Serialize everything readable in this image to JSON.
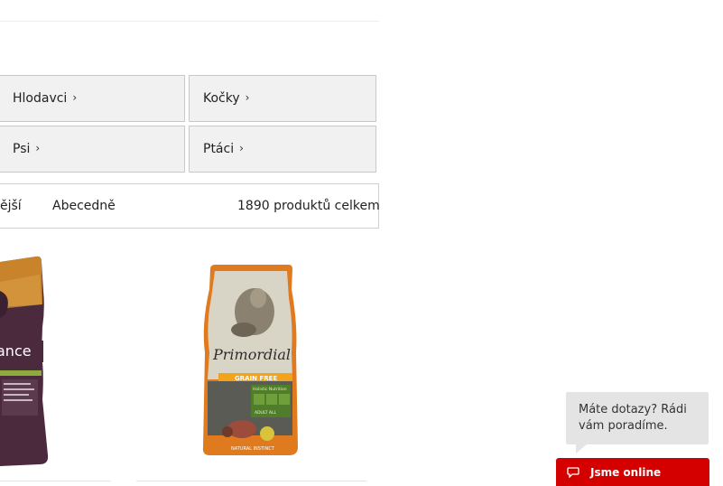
{
  "categories": [
    {
      "label": "Hlodavci",
      "chevron": "›"
    },
    {
      "label": "Kočky",
      "chevron": "›"
    },
    {
      "label": "Psi",
      "chevron": "›"
    },
    {
      "label": "Ptáci",
      "chevron": "›"
    }
  ],
  "sort": {
    "option_partial": "ější",
    "option_alpha": "Abecedně",
    "total": "1890 produktů celkem"
  },
  "products": [
    {
      "brand_text": "ance"
    },
    {
      "brand_text": "Primordial",
      "badge": "GRAIN FREE",
      "sub": "Holistic Nutrition",
      "variant": "ADULT ALL",
      "footer": "NATURAL INSTINCT"
    }
  ],
  "chat": {
    "bubble_text": "Máte dotazy? Rádi vám poradíme.",
    "button_label": "Jsme online"
  },
  "colors": {
    "tile_bg": "#f1f1f1",
    "chat_red": "#d40000",
    "bubble_bg": "#e4e4e4"
  }
}
